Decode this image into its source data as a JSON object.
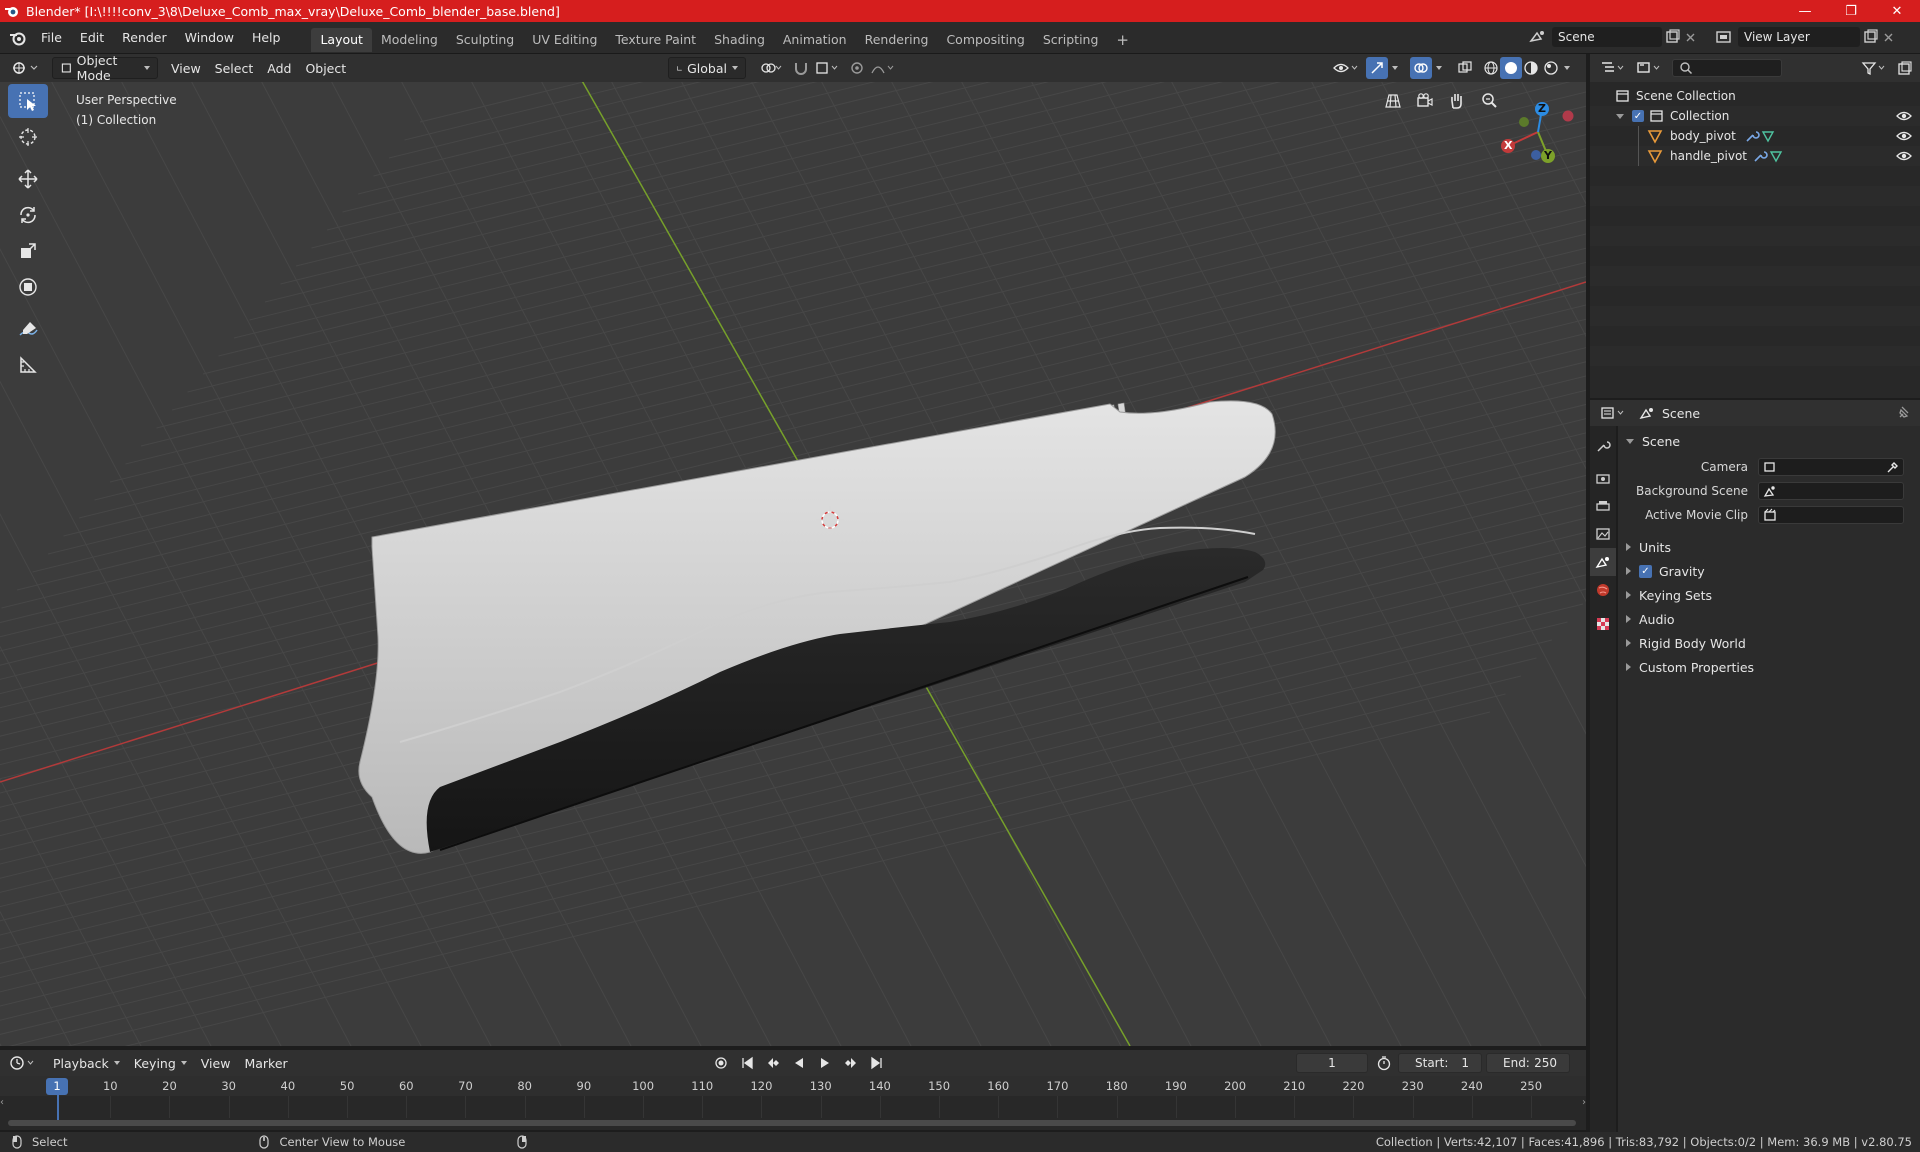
{
  "window": {
    "title": "Blender* [I:\\!!!!conv_3\\8\\Deluxe_Comb_max_vray\\Deluxe_Comb_blender_base.blend]",
    "minimize": "—",
    "maximize": "❐",
    "close": "✕"
  },
  "menu": [
    "File",
    "Edit",
    "Render",
    "Window",
    "Help"
  ],
  "workspaces": [
    "Layout",
    "Modeling",
    "Sculpting",
    "UV Editing",
    "Texture Paint",
    "Shading",
    "Animation",
    "Rendering",
    "Compositing",
    "Scripting"
  ],
  "active_workspace": "Layout",
  "add_workspace": "+",
  "scene_selector": {
    "value": "Scene"
  },
  "view_layer_selector": {
    "value": "View Layer"
  },
  "viewport_header": {
    "mode": "Object Mode",
    "menus": [
      "View",
      "Select",
      "Add",
      "Object"
    ],
    "transform_orientation": "Global"
  },
  "viewport_info": {
    "line1": "User Perspective",
    "line2": "(1) Collection"
  },
  "gizmo": {
    "x": "X",
    "y": "Y",
    "z": "Z"
  },
  "outliner": {
    "search_placeholder": "",
    "rows": [
      {
        "label": "Scene Collection"
      },
      {
        "label": "Collection"
      },
      {
        "label": "body_pivot"
      },
      {
        "label": "handle_pivot"
      }
    ]
  },
  "properties": {
    "context": "Scene",
    "panel_scene": "Scene",
    "fields": [
      {
        "label": "Camera",
        "value": ""
      },
      {
        "label": "Background Scene",
        "value": ""
      },
      {
        "label": "Active Movie Clip",
        "value": ""
      }
    ],
    "panels": [
      {
        "label": "Units",
        "checkbox": false
      },
      {
        "label": "Gravity",
        "checkbox": true
      },
      {
        "label": "Keying Sets",
        "checkbox": false
      },
      {
        "label": "Audio",
        "checkbox": false
      },
      {
        "label": "Rigid Body World",
        "checkbox": false
      },
      {
        "label": "Custom Properties",
        "checkbox": false
      }
    ]
  },
  "timeline": {
    "menus": [
      "Playback",
      "Keying",
      "View",
      "Marker"
    ],
    "current_frame": "1",
    "start_label": "Start:",
    "start_value": "1",
    "end_label": "End:",
    "end_value": "250",
    "ticks": [
      "10",
      "20",
      "30",
      "40",
      "50",
      "60",
      "70",
      "80",
      "90",
      "100",
      "110",
      "120",
      "130",
      "140",
      "150",
      "160",
      "170",
      "180",
      "190",
      "200",
      "210",
      "220",
      "230",
      "240",
      "250"
    ],
    "playhead": "1"
  },
  "statusbar": {
    "select": "Select",
    "center": "Center View to Mouse",
    "stats": "Collection | Verts:42,107 | Faces:41,896 | Tris:83,792 | Objects:0/2 | Mem: 36.9 MB | v2.80.75"
  },
  "colors": {
    "accent": "#4772b3",
    "titlebar": "#d61e1e",
    "x_axis": "#c33a3a",
    "y_axis": "#7da12a",
    "z_axis": "#2c8ce3"
  }
}
